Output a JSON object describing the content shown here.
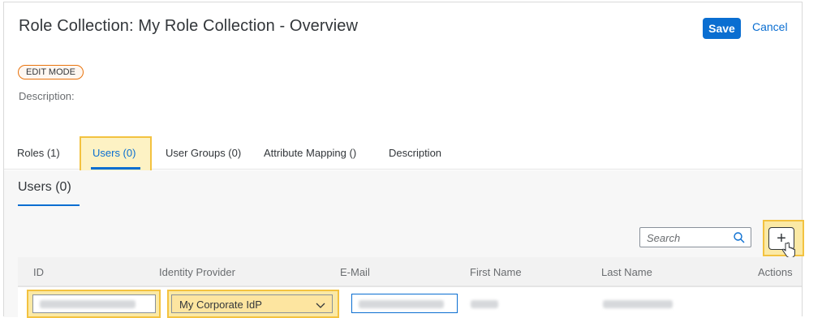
{
  "header": {
    "title": "Role Collection: My Role Collection - Overview",
    "save_label": "Save",
    "cancel_label": "Cancel",
    "mode_badge": "EDIT MODE",
    "description_label": "Description:"
  },
  "tabs": [
    {
      "label": "Roles (1)"
    },
    {
      "label": "Users (0)",
      "active": true
    },
    {
      "label": "User Groups (0)"
    },
    {
      "label": "Attribute Mapping ()"
    },
    {
      "label": "Description"
    }
  ],
  "section": {
    "title": "Users (0)",
    "search_placeholder": "Search"
  },
  "table": {
    "columns": [
      "ID",
      "Identity Provider",
      "E-Mail",
      "First Name",
      "Last Name",
      "Actions"
    ],
    "new_row": {
      "identity_provider": "My Corporate IdP"
    }
  },
  "colors": {
    "accent": "#0a6ed1",
    "highlight": "#f3c240",
    "badge_border": "#e9730c"
  },
  "icons": [
    "search-icon",
    "add-icon",
    "hand-cursor-icon",
    "chevron-down-icon"
  ]
}
